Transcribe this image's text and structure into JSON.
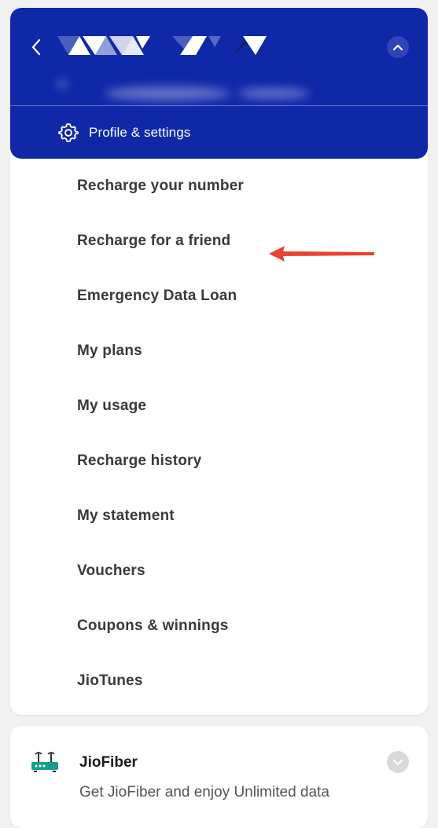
{
  "header": {
    "profile_settings_label": "Profile & settings",
    "background_color": "#0f28a8",
    "icons": {
      "back": "chevron-left-icon",
      "collapse": "chevron-up-icon",
      "settings": "gear-icon"
    }
  },
  "menu": {
    "items": [
      {
        "label": "Recharge your number"
      },
      {
        "label": "Recharge for a friend"
      },
      {
        "label": "Emergency Data Loan"
      },
      {
        "label": "My plans"
      },
      {
        "label": "My usage"
      },
      {
        "label": "Recharge history"
      },
      {
        "label": "My statement"
      },
      {
        "label": "Vouchers"
      },
      {
        "label": "Coupons & winnings"
      },
      {
        "label": "JioTunes"
      }
    ],
    "annotation_color": "#e8432e"
  },
  "jiofiber": {
    "title": "JioFiber",
    "subtitle": "Get JioFiber and enjoy Unlimited data",
    "icon": "router-icon",
    "expand_icon": "chevron-down-icon"
  }
}
